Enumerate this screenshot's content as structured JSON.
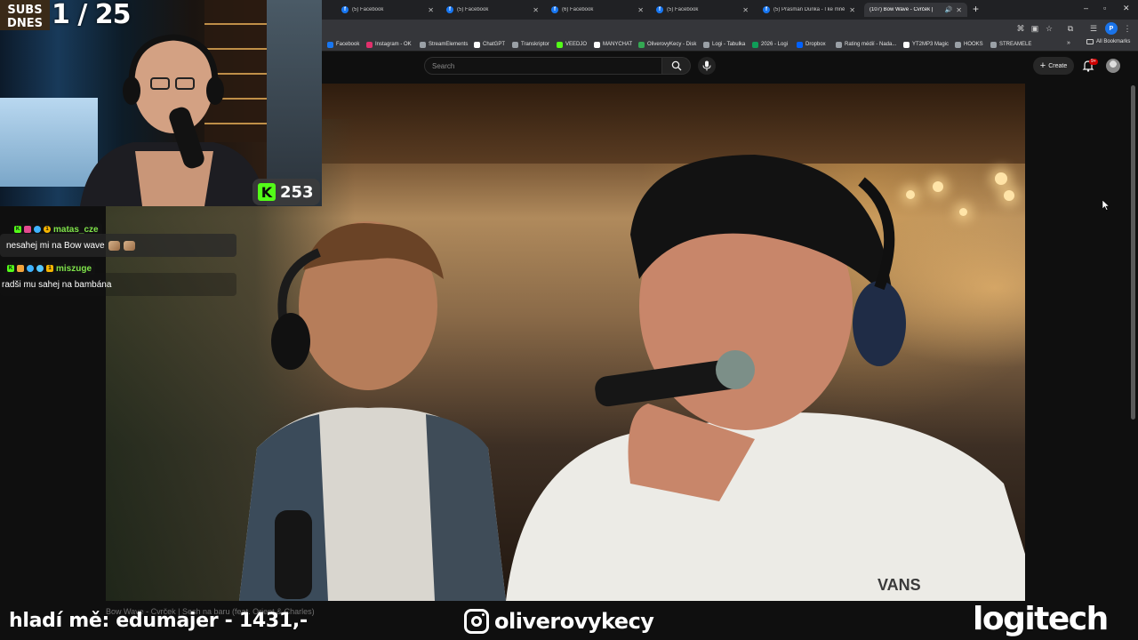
{
  "browser": {
    "tabs": [
      {
        "title": "(5) Facebook",
        "favicon": "facebook-icon"
      },
      {
        "title": "(5) Facebook",
        "favicon": "facebook-icon"
      },
      {
        "title": "(6) Facebook",
        "favicon": "facebook-icon"
      },
      {
        "title": "(5) Facebook",
        "favicon": "facebook-icon"
      },
      {
        "title": "(5) Prasman Dunka - I ke mně d",
        "favicon": "facebook-icon"
      },
      {
        "title": "(107) Bow Wave - Cvrček | ",
        "favicon": "youtube-icon",
        "active": true
      }
    ],
    "profile_initial": "P",
    "bookmarks": [
      {
        "label": "Facebook",
        "color": "#1877f2"
      },
      {
        "label": "Instagram - OK",
        "color": "#e1306c"
      },
      {
        "label": "StreamElements",
        "color": "#9aa0a6"
      },
      {
        "label": "ChatGPT",
        "color": "#ffffff"
      },
      {
        "label": "Transkriptor",
        "color": "#9aa0a6"
      },
      {
        "label": "VEEDJO",
        "color": "#53fc18"
      },
      {
        "label": "MANYCHAT",
        "color": "#ffffff"
      },
      {
        "label": "OliverovyKecy - Disk",
        "color": "#34a853"
      },
      {
        "label": "Logi - Tabulka",
        "color": "#9aa0a6"
      },
      {
        "label": "2026 - Logi",
        "color": "#0f9d58"
      },
      {
        "label": "Dropbox",
        "color": "#0061ff"
      },
      {
        "label": "Rating médií - Nada...",
        "color": "#9aa0a6"
      },
      {
        "label": "YT2MP3 Magic",
        "color": "#ffffff"
      },
      {
        "label": "HOOKS",
        "color": "#9aa0a6"
      },
      {
        "label": "STREAMELE",
        "color": "#9aa0a6"
      }
    ],
    "all_bookmarks": "All Bookmarks"
  },
  "youtube": {
    "search_placeholder": "Search",
    "create_label": "Create",
    "notifications_badge": "9+",
    "video_title": "Bow Wave - Cvrček | Sesh na baru (feat. Orient & Charles)"
  },
  "overlay": {
    "subs_label_top": "SUBS",
    "subs_label_bottom": "DNES",
    "subs_count": "1 / 25",
    "kick_viewers": "253",
    "chat": [
      {
        "user": "matas_cze",
        "message": "nesahej mi na Bow wave"
      },
      {
        "user": "miszuge",
        "message": "radši mu sahej na bambána"
      }
    ],
    "ticker": "hladí mě: edumajer - 1431,-",
    "instagram_handle": "oliverovykecy",
    "sponsor": "logitech"
  },
  "colors": {
    "kick_green": "#53fc18",
    "youtube_red": "#ff0000",
    "chat_name": "#7fe34a"
  }
}
